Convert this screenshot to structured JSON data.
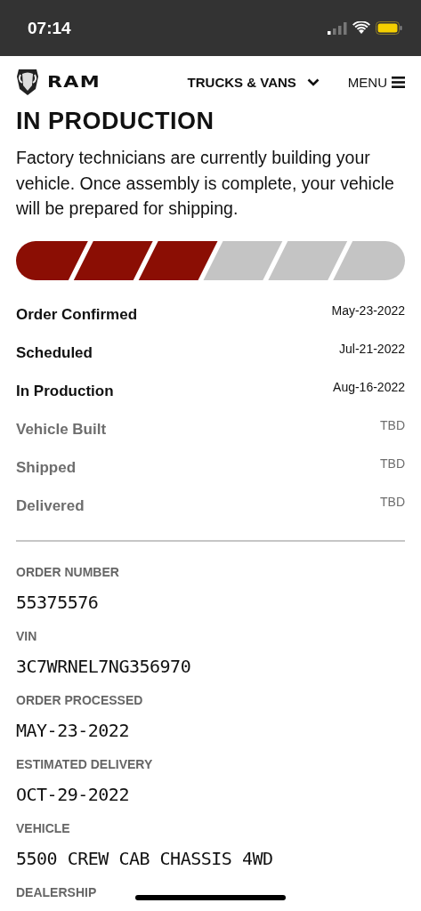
{
  "status_bar": {
    "time": "07:14"
  },
  "header": {
    "logo": "RAM",
    "nav": "TRUCKS & VANS",
    "menu": "MENU"
  },
  "title": "IN PRODUCTION",
  "description": "Factory technicians are currently building your vehicle. Once assembly is complete, your vehicle will be prepared for shipping.",
  "progress": {
    "segments": [
      {
        "filled": true
      },
      {
        "filled": true
      },
      {
        "filled": true
      },
      {
        "filled": false
      },
      {
        "filled": false
      },
      {
        "filled": false
      }
    ]
  },
  "milestones": [
    {
      "label": "Order Confirmed",
      "date": "May-23-2022",
      "reached": true
    },
    {
      "label": "Scheduled",
      "date": "Jul-21-2022",
      "reached": true
    },
    {
      "label": "In Production",
      "date": "Aug-16-2022",
      "reached": true
    },
    {
      "label": "Vehicle Built",
      "date": "TBD",
      "reached": false
    },
    {
      "label": "Shipped",
      "date": "TBD",
      "reached": false
    },
    {
      "label": "Delivered",
      "date": "TBD",
      "reached": false
    }
  ],
  "details": [
    {
      "label": "ORDER NUMBER",
      "value": "55375576"
    },
    {
      "label": "VIN",
      "value": "3C7WRNEL7NG356970"
    },
    {
      "label": "ORDER PROCESSED",
      "value": "MAY-23-2022"
    },
    {
      "label": "ESTIMATED DELIVERY",
      "value": "OCT-29-2022"
    },
    {
      "label": "VEHICLE",
      "value": "5500 CREW CAB CHASSIS 4WD"
    },
    {
      "label": "DEALERSHIP"
    }
  ]
}
